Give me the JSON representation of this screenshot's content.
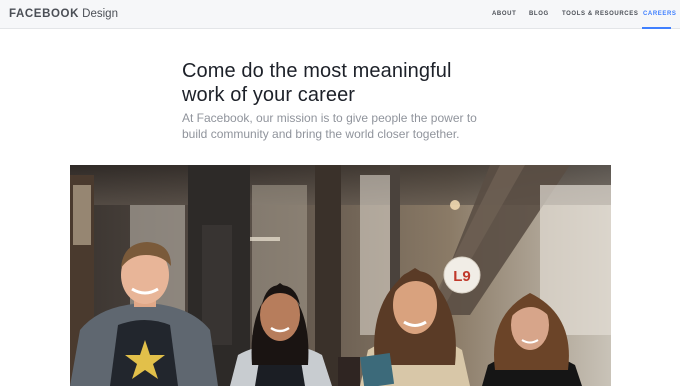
{
  "brand": {
    "name_bold": "FACEBOOK",
    "name_light": " Design"
  },
  "nav": {
    "items": [
      {
        "label": "ABOUT",
        "active": false
      },
      {
        "label": "BLOG",
        "active": false
      },
      {
        "label": "TOOLS & RESOURCES",
        "active": false
      },
      {
        "label": "CAREERS",
        "active": true
      }
    ]
  },
  "hero": {
    "headline_line1": "Come do the most meaningful",
    "headline_line2": "work of your career",
    "subtext_line1": "At Facebook, our mission is to give people the power to",
    "subtext_line2": "build community and bring the world closer together."
  },
  "photo": {
    "sign_text": "L9"
  },
  "colors": {
    "accent": "#4080ff",
    "text": "#4b4f56",
    "headline": "#1d2129",
    "muted": "#90949c",
    "topbar": "#f6f7f9"
  }
}
